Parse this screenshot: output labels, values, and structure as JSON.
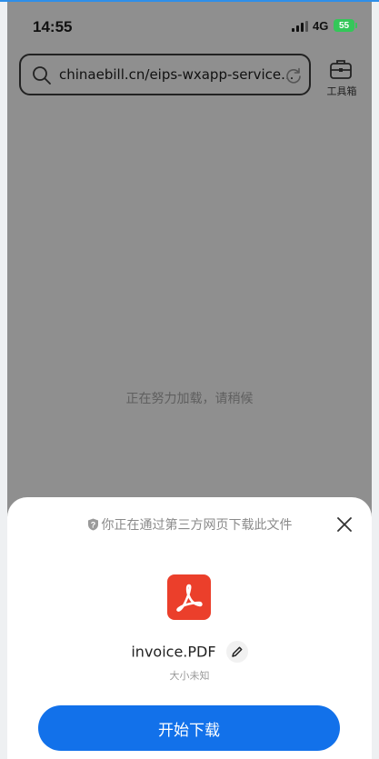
{
  "status_bar": {
    "time": "14:55",
    "network": "4G",
    "battery": "55"
  },
  "browser": {
    "url": "chinaebill.cn/eips-wxapp-service...",
    "toolbox_label": "工具箱",
    "loading_text": "正在努力加载，请稍候"
  },
  "download_sheet": {
    "notice": "你正在通过第三方网页下载此文件",
    "file_name": "invoice.PDF",
    "file_size": "大小未知",
    "download_label": "开始下载"
  },
  "colors": {
    "accent": "#1271ea",
    "pdf_icon": "#eb3f2b",
    "battery": "#34c759",
    "overlay": "#8f8f8f"
  }
}
